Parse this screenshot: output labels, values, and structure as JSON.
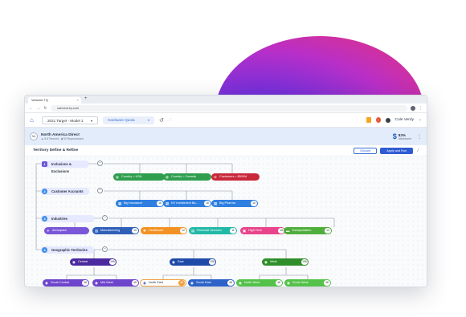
{
  "browser": {
    "tab_title": "Varicent TQ",
    "tab_close": "×",
    "new_tab": "+",
    "url": "varicent.tq.com"
  },
  "app": {
    "plan_select": "2021 Target - Model 1",
    "quota_select": "Hardware Quota",
    "user_name": "Cole Verdy"
  },
  "territory": {
    "logo": "NA",
    "name": "North America Direct",
    "sub": "▲ 5.6 Tenured · ▮ 92 Reprocessed",
    "quota_pct": "83%",
    "quota_sub": "Attainment"
  },
  "section": {
    "title": "Territory Define & Refine",
    "cancel_label": "Discard",
    "apply_label": "Apply and Run"
  },
  "groups": [
    {
      "num": "1",
      "label": "Inclusions & Exclusions"
    },
    {
      "num": "2",
      "label": "Customer Accounts"
    },
    {
      "num": "3",
      "label": "Industries"
    },
    {
      "num": "4",
      "label": "Geographic Territories"
    }
  ],
  "inclusions": [
    {
      "label": "Country = USA",
      "color": "#2e9e4e"
    },
    {
      "label": "Country = Canada",
      "color": "#2e9e4e"
    },
    {
      "label": "Customers > $500M",
      "color": "#c8283a"
    }
  ],
  "accounts": [
    {
      "label": "Big Insurance",
      "count": "16"
    },
    {
      "label": "NY Investment Ba...",
      "count": "16"
    },
    {
      "label": "Big Pharma",
      "count": "16"
    }
  ],
  "industries": [
    {
      "label": "Aerospace",
      "color": "#7a56d8",
      "count": ""
    },
    {
      "label": "Manufacturing",
      "color": "#2f5fb8",
      "count": "10"
    },
    {
      "label": "Healthcare",
      "color": "#f39224",
      "count": "12"
    },
    {
      "label": "Financial Services",
      "color": "#22b8a8",
      "count": "11"
    },
    {
      "label": "High Tech",
      "color": "#e8458c",
      "count": "18"
    },
    {
      "label": "Transportation",
      "color": "#4fae3c",
      "count": "14"
    }
  ],
  "regions": [
    {
      "label": "Central",
      "count": "196"
    },
    {
      "label": "East",
      "count": "196"
    },
    {
      "label": "West",
      "count": "196"
    }
  ],
  "subregions": [
    {
      "label": "South Central",
      "count": "48",
      "color": "#6e44cc"
    },
    {
      "label": "Mid West",
      "count": "48",
      "color": "#6e44cc"
    },
    {
      "label": "North East",
      "count": "48",
      "color": "outline"
    },
    {
      "label": "South East",
      "count": "48",
      "color": "#2d63c8"
    },
    {
      "label": "North West",
      "count": "48",
      "color": "#54c24a"
    },
    {
      "label": "South West",
      "count": "48",
      "color": "#54c24a"
    }
  ],
  "colors": {
    "accent": "#2f5bd3",
    "band": "#e3ecfa"
  }
}
